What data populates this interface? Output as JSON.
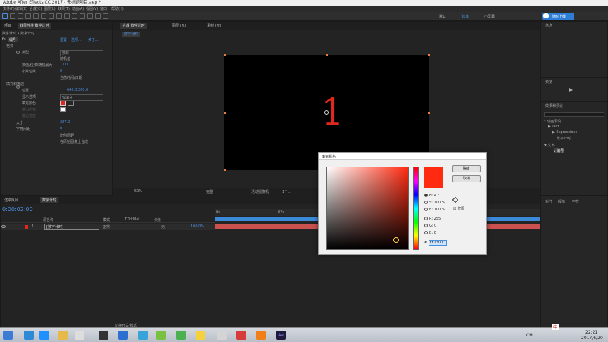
{
  "window": {
    "title": "Adobe After Effects CC 2017 - 无标题项目.aep *"
  },
  "menu": [
    "文件(F)",
    "编辑(E)",
    "合成(C)",
    "图层(L)",
    "效果(T)",
    "动画(A)",
    "视图(V)",
    "窗口",
    "帮助(H)"
  ],
  "toolbar": {
    "workspace_tabs": [
      "默认",
      "标准",
      "小屏幕"
    ],
    "active_workspace": "标准",
    "login_label": "随时上线"
  },
  "effect_controls": {
    "tabs": [
      "项目",
      "效果控件 数字计时"
    ],
    "breadcrumb": "数字计时 • 数字计时",
    "effect_name": "编号",
    "effect_links": [
      "重置",
      "选项...",
      "关于..."
    ],
    "rows": [
      {
        "label": "格式",
        "value": ""
      },
      {
        "label": "类型",
        "value": "数目"
      },
      {
        "label": "",
        "value": "随机值"
      },
      {
        "label": "数值/位移/随机最大",
        "value": "1.00"
      },
      {
        "label": "小数位数",
        "value": "0"
      },
      {
        "label": "",
        "value": "当前时间/日期"
      },
      {
        "label": "填充和描边",
        "value": ""
      },
      {
        "label": "位置",
        "value": "640.0,360.0"
      },
      {
        "label": "显示选项",
        "value": "仅填充"
      },
      {
        "label": "填充颜色",
        "value": ""
      },
      {
        "label": "描边颜色",
        "value": ""
      },
      {
        "label": "描边宽度",
        "value": ""
      },
      {
        "label": "大小",
        "value": "287.0"
      },
      {
        "label": "字符间距",
        "value": "0"
      },
      {
        "label": "",
        "value": "比例间距"
      },
      {
        "label": "",
        "value": "在原始图像上合成"
      }
    ]
  },
  "composition": {
    "tabs": [
      "合成 数字计时",
      "图层 (无)",
      "素材 (无)"
    ],
    "comp_tab_label": "数字计时",
    "canvas_text": "1",
    "zoom": "50%",
    "quality": "完整",
    "camera": "活动摄像机",
    "views": "1个..."
  },
  "color_dialog": {
    "title": "填充颜色",
    "ok_label": "确定",
    "cancel_label": "取消",
    "values": {
      "H": "H: 4 °",
      "S": "S: 100 %",
      "B": "B: 100 %",
      "R": "R: 255",
      "G": "G: 0",
      "Bl": "B: 0"
    },
    "hex": "FF1300",
    "eyedropper_check": "仅限",
    "swatch_color": "#ff2a10"
  },
  "timeline": {
    "tabs": [
      "渲染队列",
      "数字计时"
    ],
    "timecode": "0:00:02:00",
    "columns": [
      "源名称",
      "模式",
      "T TrkMat",
      "父级"
    ],
    "layer": {
      "index": "1",
      "name": "[数字计时]",
      "mode": "正常",
      "parent": "无",
      "opacity": "100.0%"
    },
    "ruler_labels": [
      "0s",
      "02s"
    ],
    "footer": "切换开关/模式"
  },
  "right_panels": {
    "info_title": "信息",
    "preview_title": "预览",
    "effects_title": "效果和预设",
    "tree": [
      "* 动画预设",
      "▶ Text",
      "▶ Expressions",
      "数字计时",
      "▼ 文本",
      "▸ 编号"
    ],
    "bottom_labels": [
      "对齐",
      "段落",
      "字符"
    ]
  },
  "taskbar": {
    "time": "22:21",
    "date": "2017/6/20",
    "lang": "CH",
    "ime": "中"
  }
}
